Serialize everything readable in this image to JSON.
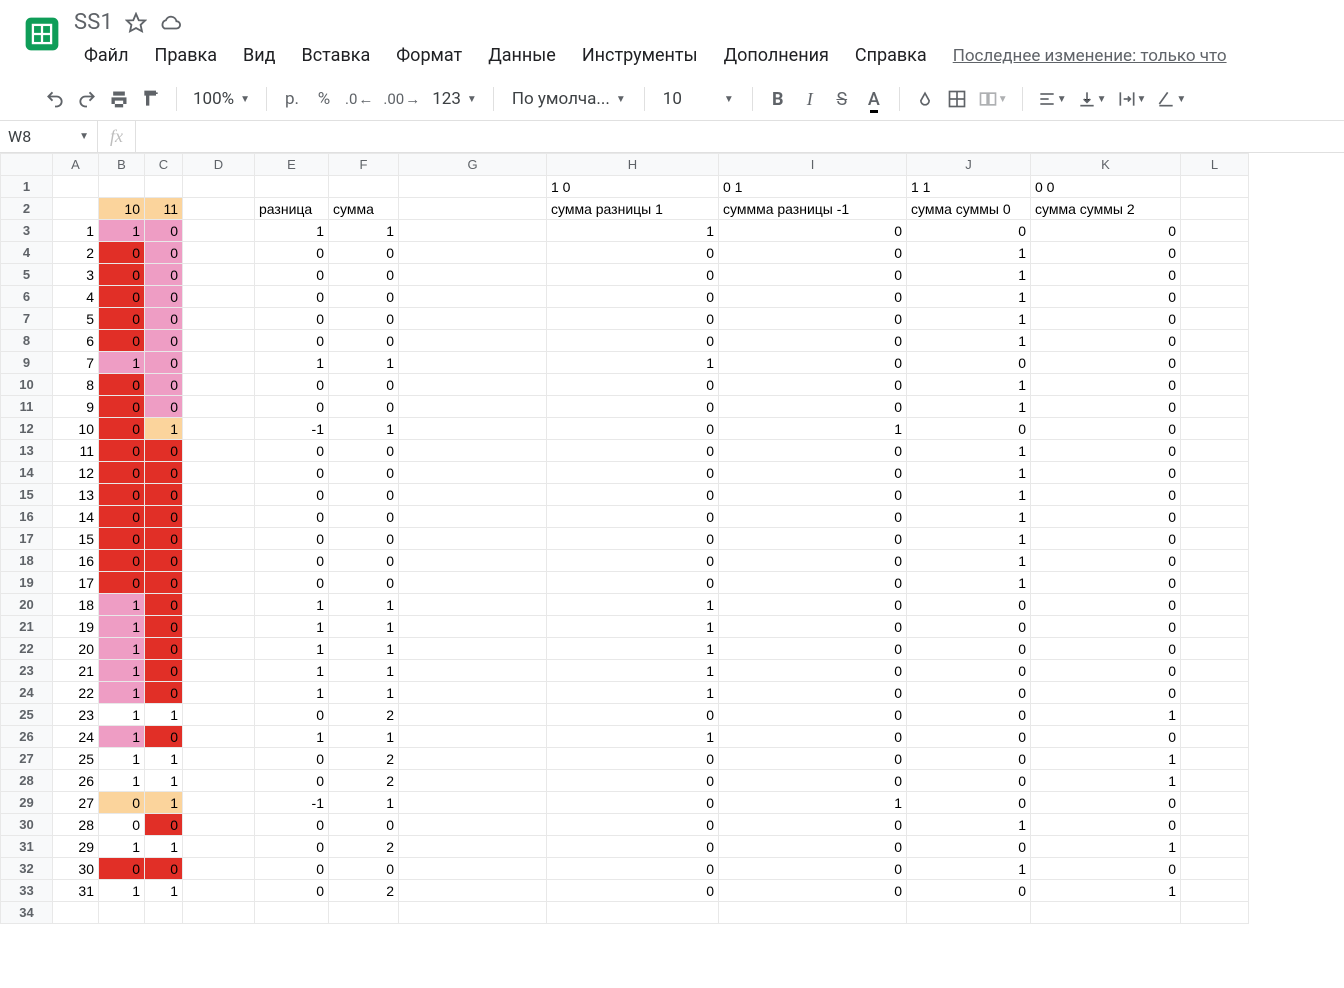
{
  "doc": {
    "title": "SS1",
    "last_edit": "Последнее изменение: только что"
  },
  "menu": {
    "file": "Файл",
    "edit": "Правка",
    "view": "Вид",
    "insert": "Вставка",
    "format": "Формат",
    "data": "Данные",
    "tools": "Инструменты",
    "addons": "Дополнения",
    "help": "Справка"
  },
  "toolbar": {
    "zoom": "100%",
    "currency": "р.",
    "percent": "%",
    "dec_dec": ".0",
    "inc_dec": ".00",
    "numfmt": "123",
    "font": "По умолча...",
    "size": "10"
  },
  "fx": {
    "name": "W8"
  },
  "columns": [
    "A",
    "B",
    "C",
    "D",
    "E",
    "F",
    "G",
    "H",
    "I",
    "J",
    "K",
    "L"
  ],
  "cells": {
    "1": {
      "H": "1 0",
      "I": "0 1",
      "J": "1 1",
      "K": "0 0"
    },
    "2": {
      "B": "10",
      "C": "11",
      "E": "разница",
      "F": "сумма",
      "H": "сумма разницы 1",
      "I": "суммма разницы -1",
      "J": "сумма суммы 0",
      "K": "сумма суммы 2"
    },
    "3": {
      "A": "1",
      "B": "1",
      "C": "0",
      "E": "1",
      "F": "1",
      "H": "1",
      "I": "0",
      "J": "0",
      "K": "0"
    },
    "4": {
      "A": "2",
      "B": "0",
      "C": "0",
      "E": "0",
      "F": "0",
      "H": "0",
      "I": "0",
      "J": "1",
      "K": "0"
    },
    "5": {
      "A": "3",
      "B": "0",
      "C": "0",
      "E": "0",
      "F": "0",
      "H": "0",
      "I": "0",
      "J": "1",
      "K": "0"
    },
    "6": {
      "A": "4",
      "B": "0",
      "C": "0",
      "E": "0",
      "F": "0",
      "H": "0",
      "I": "0",
      "J": "1",
      "K": "0"
    },
    "7": {
      "A": "5",
      "B": "0",
      "C": "0",
      "E": "0",
      "F": "0",
      "H": "0",
      "I": "0",
      "J": "1",
      "K": "0"
    },
    "8": {
      "A": "6",
      "B": "0",
      "C": "0",
      "E": "0",
      "F": "0",
      "H": "0",
      "I": "0",
      "J": "1",
      "K": "0"
    },
    "9": {
      "A": "7",
      "B": "1",
      "C": "0",
      "E": "1",
      "F": "1",
      "H": "1",
      "I": "0",
      "J": "0",
      "K": "0"
    },
    "10": {
      "A": "8",
      "B": "0",
      "C": "0",
      "E": "0",
      "F": "0",
      "H": "0",
      "I": "0",
      "J": "1",
      "K": "0"
    },
    "11": {
      "A": "9",
      "B": "0",
      "C": "0",
      "E": "0",
      "F": "0",
      "H": "0",
      "I": "0",
      "J": "1",
      "K": "0"
    },
    "12": {
      "A": "10",
      "B": "0",
      "C": "1",
      "E": "-1",
      "F": "1",
      "H": "0",
      "I": "1",
      "J": "0",
      "K": "0"
    },
    "13": {
      "A": "11",
      "B": "0",
      "C": "0",
      "E": "0",
      "F": "0",
      "H": "0",
      "I": "0",
      "J": "1",
      "K": "0"
    },
    "14": {
      "A": "12",
      "B": "0",
      "C": "0",
      "E": "0",
      "F": "0",
      "H": "0",
      "I": "0",
      "J": "1",
      "K": "0"
    },
    "15": {
      "A": "13",
      "B": "0",
      "C": "0",
      "E": "0",
      "F": "0",
      "H": "0",
      "I": "0",
      "J": "1",
      "K": "0"
    },
    "16": {
      "A": "14",
      "B": "0",
      "C": "0",
      "E": "0",
      "F": "0",
      "H": "0",
      "I": "0",
      "J": "1",
      "K": "0"
    },
    "17": {
      "A": "15",
      "B": "0",
      "C": "0",
      "E": "0",
      "F": "0",
      "H": "0",
      "I": "0",
      "J": "1",
      "K": "0"
    },
    "18": {
      "A": "16",
      "B": "0",
      "C": "0",
      "E": "0",
      "F": "0",
      "H": "0",
      "I": "0",
      "J": "1",
      "K": "0"
    },
    "19": {
      "A": "17",
      "B": "0",
      "C": "0",
      "E": "0",
      "F": "0",
      "H": "0",
      "I": "0",
      "J": "1",
      "K": "0"
    },
    "20": {
      "A": "18",
      "B": "1",
      "C": "0",
      "E": "1",
      "F": "1",
      "H": "1",
      "I": "0",
      "J": "0",
      "K": "0"
    },
    "21": {
      "A": "19",
      "B": "1",
      "C": "0",
      "E": "1",
      "F": "1",
      "H": "1",
      "I": "0",
      "J": "0",
      "K": "0"
    },
    "22": {
      "A": "20",
      "B": "1",
      "C": "0",
      "E": "1",
      "F": "1",
      "H": "1",
      "I": "0",
      "J": "0",
      "K": "0"
    },
    "23": {
      "A": "21",
      "B": "1",
      "C": "0",
      "E": "1",
      "F": "1",
      "H": "1",
      "I": "0",
      "J": "0",
      "K": "0"
    },
    "24": {
      "A": "22",
      "B": "1",
      "C": "0",
      "E": "1",
      "F": "1",
      "H": "1",
      "I": "0",
      "J": "0",
      "K": "0"
    },
    "25": {
      "A": "23",
      "B": "1",
      "C": "1",
      "E": "0",
      "F": "2",
      "H": "0",
      "I": "0",
      "J": "0",
      "K": "1"
    },
    "26": {
      "A": "24",
      "B": "1",
      "C": "0",
      "E": "1",
      "F": "1",
      "H": "1",
      "I": "0",
      "J": "0",
      "K": "0"
    },
    "27": {
      "A": "25",
      "B": "1",
      "C": "1",
      "E": "0",
      "F": "2",
      "H": "0",
      "I": "0",
      "J": "0",
      "K": "1"
    },
    "28": {
      "A": "26",
      "B": "1",
      "C": "1",
      "E": "0",
      "F": "2",
      "H": "0",
      "I": "0",
      "J": "0",
      "K": "1"
    },
    "29": {
      "A": "27",
      "B": "0",
      "C": "1",
      "E": "-1",
      "F": "1",
      "H": "0",
      "I": "1",
      "J": "0",
      "K": "0"
    },
    "30": {
      "A": "28",
      "B": "0",
      "C": "0",
      "E": "0",
      "F": "0",
      "H": "0",
      "I": "0",
      "J": "1",
      "K": "0"
    },
    "31": {
      "A": "29",
      "B": "1",
      "C": "1",
      "E": "0",
      "F": "2",
      "H": "0",
      "I": "0",
      "J": "0",
      "K": "1"
    },
    "32": {
      "A": "30",
      "B": "0",
      "C": "0",
      "E": "0",
      "F": "0",
      "H": "0",
      "I": "0",
      "J": "1",
      "K": "0"
    },
    "33": {
      "A": "31",
      "B": "1",
      "C": "1",
      "E": "0",
      "F": "2",
      "H": "0",
      "I": "0",
      "J": "0",
      "K": "1"
    }
  },
  "bg": {
    "2": {
      "B": "orange",
      "C": "orange"
    },
    "3": {
      "B": "pink",
      "C": "pink"
    },
    "4": {
      "B": "red",
      "C": "pink"
    },
    "5": {
      "B": "red",
      "C": "pink"
    },
    "6": {
      "B": "red",
      "C": "pink"
    },
    "7": {
      "B": "red",
      "C": "pink"
    },
    "8": {
      "B": "red",
      "C": "pink"
    },
    "9": {
      "B": "pink",
      "C": "pink"
    },
    "10": {
      "B": "red",
      "C": "pink"
    },
    "11": {
      "B": "red",
      "C": "pink"
    },
    "12": {
      "B": "red",
      "C": "orange"
    },
    "13": {
      "B": "red",
      "C": "red"
    },
    "14": {
      "B": "red",
      "C": "red"
    },
    "15": {
      "B": "red",
      "C": "red"
    },
    "16": {
      "B": "red",
      "C": "red"
    },
    "17": {
      "B": "red",
      "C": "red"
    },
    "18": {
      "B": "red",
      "C": "red"
    },
    "19": {
      "B": "red",
      "C": "red"
    },
    "20": {
      "B": "pink",
      "C": "red"
    },
    "21": {
      "B": "pink",
      "C": "red"
    },
    "22": {
      "B": "pink",
      "C": "red"
    },
    "23": {
      "B": "pink",
      "C": "red"
    },
    "24": {
      "B": "pink",
      "C": "red"
    },
    "26": {
      "B": "pink",
      "C": "red"
    },
    "29": {
      "B": "orange",
      "C": "orange"
    },
    "30": {
      "C": "red"
    },
    "32": {
      "B": "red",
      "C": "red"
    }
  },
  "text_cells": [
    "E2",
    "F2",
    "H1",
    "I1",
    "J1",
    "K1",
    "H2",
    "I2",
    "J2",
    "K2"
  ]
}
